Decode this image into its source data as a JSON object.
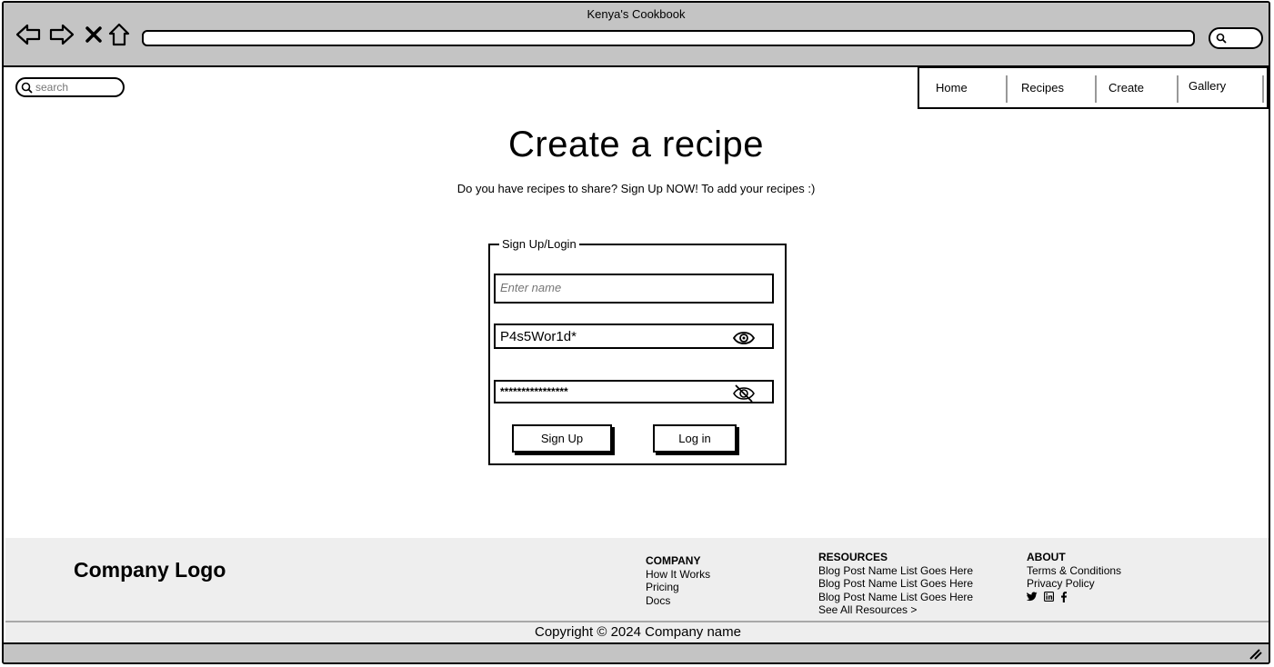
{
  "window": {
    "title": "Kenya's Cookbook"
  },
  "browser": {
    "back_icon": "back-arrow-icon",
    "forward_icon": "forward-arrow-icon",
    "close_icon": "close-icon",
    "home_icon": "home-icon",
    "address_value": "",
    "search_icon": "search-icon"
  },
  "site_search": {
    "placeholder": "search"
  },
  "nav": {
    "items": [
      {
        "label": "Home"
      },
      {
        "label": "Recipes"
      },
      {
        "label": "Create"
      },
      {
        "label": "Gallery"
      }
    ]
  },
  "main": {
    "title": "Create a recipe",
    "subtitle": "Do you have recipes to share? Sign Up NOW! To add your recipes :)"
  },
  "form": {
    "legend": "Sign Up/Login",
    "name_placeholder": "Enter name",
    "password_visible_value": "P4s5Wor1d*",
    "password_hidden_value": "****************",
    "signup_label": "Sign Up",
    "login_label": "Log in"
  },
  "footer": {
    "logo": "Company Logo",
    "company": {
      "heading": "COMPANY",
      "links": [
        "How It Works",
        "Pricing",
        "Docs"
      ]
    },
    "resources": {
      "heading": "RESOURCES",
      "links": [
        "Blog Post Name List Goes Here",
        "Blog Post Name List Goes Here",
        "Blog Post Name List Goes Here",
        "See All Resources >"
      ]
    },
    "about": {
      "heading": "ABOUT",
      "links": [
        "Terms & Conditions",
        "Privacy Policy"
      ]
    },
    "social_icons": [
      "twitter-icon",
      "linkedin-icon",
      "facebook-icon"
    ],
    "copyright": "Copyright © 2024 Company name"
  }
}
